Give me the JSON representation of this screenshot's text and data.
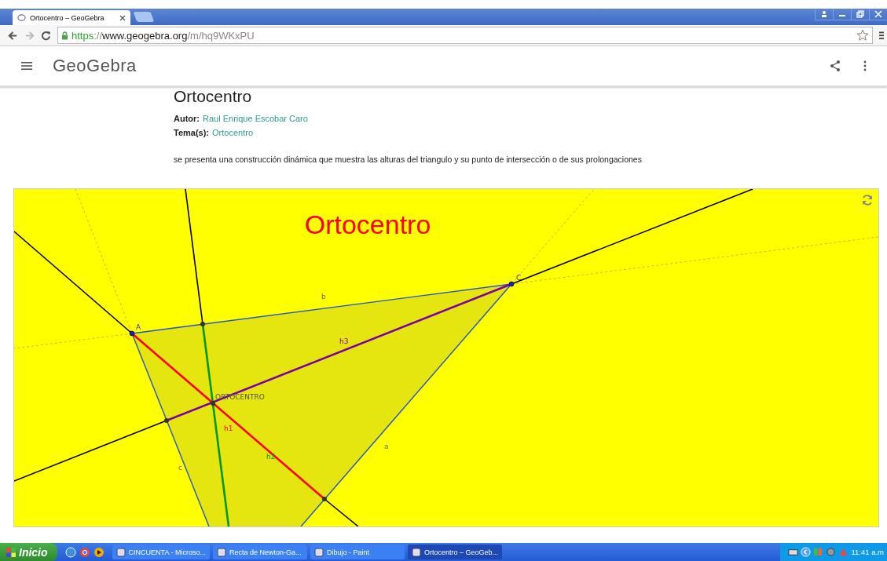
{
  "browser": {
    "tab": {
      "title": "Ortocentro – GeoGebra",
      "selected": true
    },
    "url": {
      "scheme": "https",
      "separator": "://",
      "host": "www.geogebra.org",
      "path": "/m/hq9WKxPU"
    }
  },
  "header": {
    "logo": "GeoGebra"
  },
  "page": {
    "title": "Ortocentro",
    "author_label": "Autor:",
    "author": "Raul Enrique Escobar Caro",
    "topics_label": "Tema(s):",
    "topic": "Ortocentro",
    "description": "se presenta una construcción dinámica que muestra las alturas del triangulo y su punto de intersección o de sus prolongaciones"
  },
  "applet": {
    "title": "Ortocentro",
    "labels": [
      {
        "text": "b",
        "kind": "side"
      },
      {
        "text": "A",
        "kind": "point"
      },
      {
        "text": "C",
        "kind": "point"
      },
      {
        "text": "h3",
        "kind": "altitude",
        "color": "#7f00a0"
      },
      {
        "text": "ORTOCENTRO",
        "kind": "point"
      },
      {
        "text": "h1",
        "kind": "altitude",
        "color": "#ff0000"
      },
      {
        "text": "h2",
        "kind": "altitude",
        "color": "#009900"
      },
      {
        "text": "a",
        "kind": "side"
      },
      {
        "text": "c",
        "kind": "side"
      }
    ]
  },
  "taskbar": {
    "start": "Inicio",
    "windows": [
      {
        "title": "CINCUENTA - Microso...",
        "selected": false
      },
      {
        "title": "Recta de Newton-Ga...",
        "selected": false
      },
      {
        "title": "Dibujo - Paint",
        "selected": false
      },
      {
        "title": "Ortocentro – GeoGeb...",
        "selected": true
      }
    ],
    "clock": "11:41 a.m"
  }
}
